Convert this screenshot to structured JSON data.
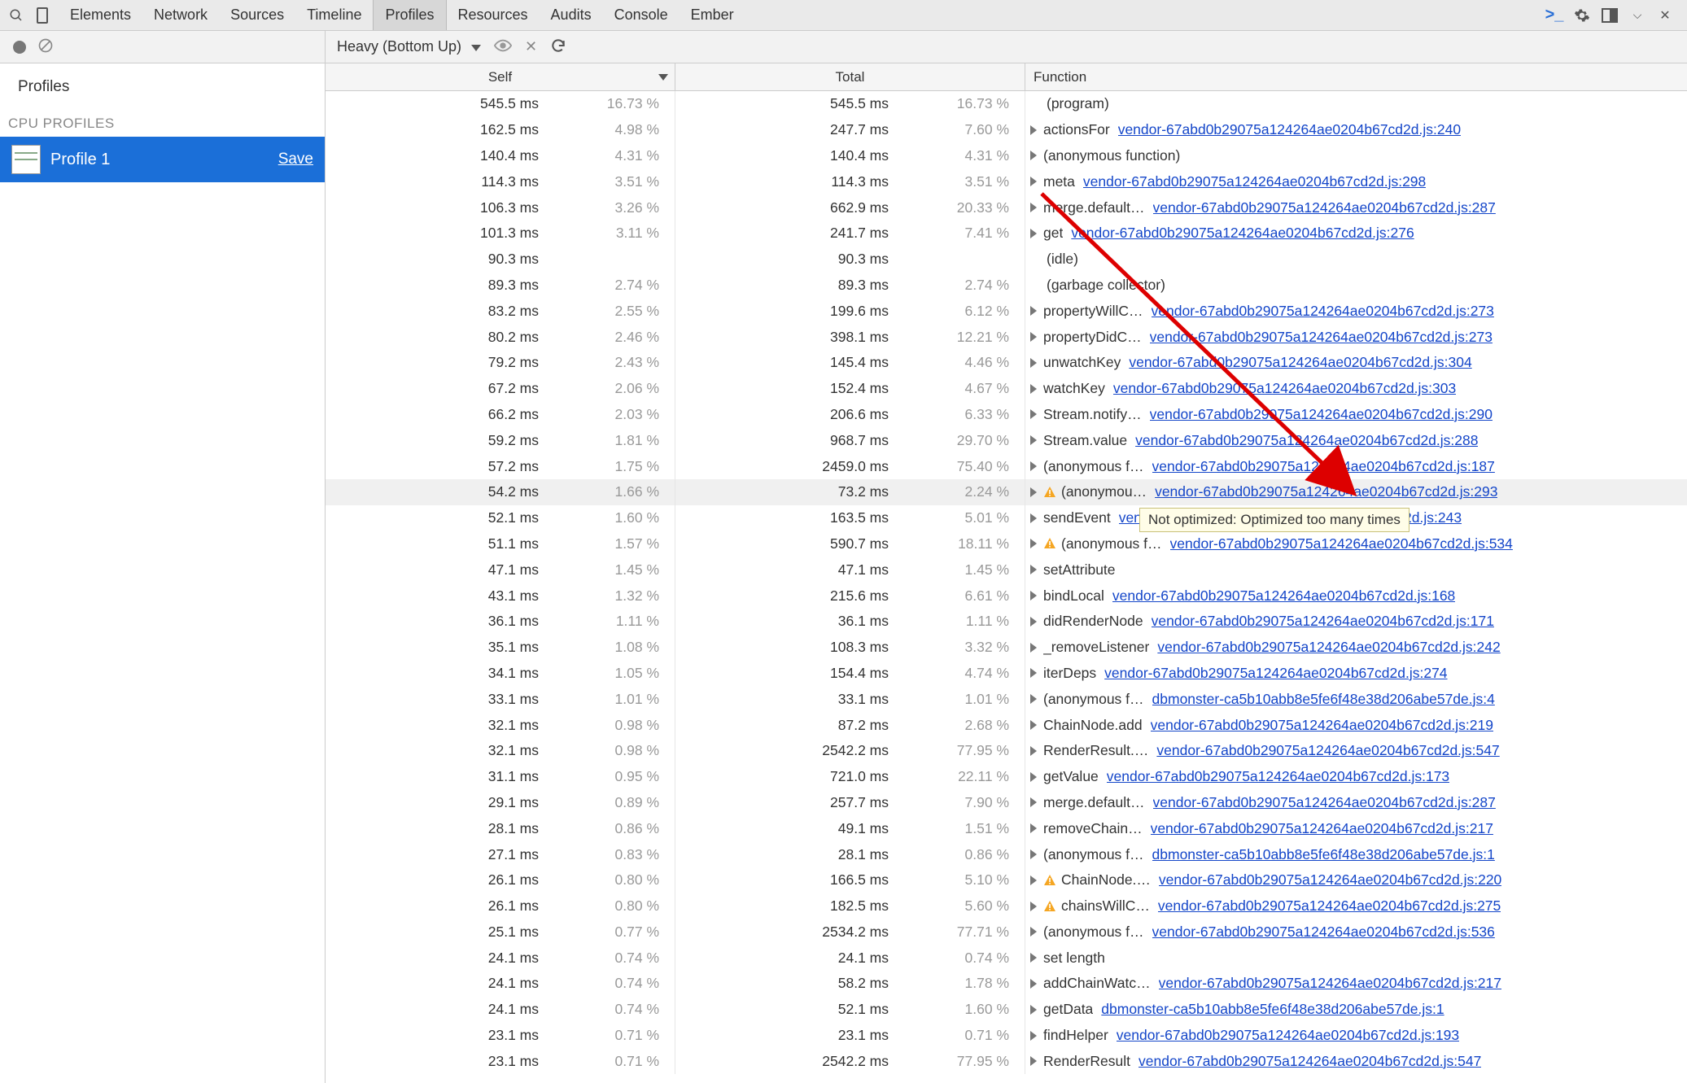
{
  "toolbar": {
    "tabs": [
      "Elements",
      "Network",
      "Sources",
      "Timeline",
      "Profiles",
      "Resources",
      "Audits",
      "Console",
      "Ember"
    ],
    "active_tab_index": 4
  },
  "subtoolbar": {
    "view_mode": "Heavy (Bottom Up)"
  },
  "sidebar": {
    "title": "Profiles",
    "section": "CPU PROFILES",
    "item_label": "Profile 1",
    "save_label": "Save"
  },
  "columns": {
    "self": "Self",
    "total": "Total",
    "fn": "Function"
  },
  "tooltip": "Not optimized: Optimized too many times",
  "rows": [
    {
      "self_ms": "545.5 ms",
      "self_pct": "16.73 %",
      "total_ms": "545.5 ms",
      "total_pct": "16.73 %",
      "fn": "(program)",
      "link": "",
      "expand": false,
      "warn": false
    },
    {
      "self_ms": "162.5 ms",
      "self_pct": "4.98 %",
      "total_ms": "247.7 ms",
      "total_pct": "7.60 %",
      "fn": "actionsFor",
      "link": "vendor-67abd0b29075a124264ae0204b67cd2d.js:240",
      "expand": true,
      "warn": false
    },
    {
      "self_ms": "140.4 ms",
      "self_pct": "4.31 %",
      "total_ms": "140.4 ms",
      "total_pct": "4.31 %",
      "fn": "(anonymous function)",
      "link": "",
      "expand": true,
      "warn": false
    },
    {
      "self_ms": "114.3 ms",
      "self_pct": "3.51 %",
      "total_ms": "114.3 ms",
      "total_pct": "3.51 %",
      "fn": "meta",
      "link": "vendor-67abd0b29075a124264ae0204b67cd2d.js:298",
      "expand": true,
      "warn": false
    },
    {
      "self_ms": "106.3 ms",
      "self_pct": "3.26 %",
      "total_ms": "662.9 ms",
      "total_pct": "20.33 %",
      "fn": "merge.default…",
      "link": "vendor-67abd0b29075a124264ae0204b67cd2d.js:287",
      "expand": true,
      "warn": false
    },
    {
      "self_ms": "101.3 ms",
      "self_pct": "3.11 %",
      "total_ms": "241.7 ms",
      "total_pct": "7.41 %",
      "fn": "get",
      "link": "vendor-67abd0b29075a124264ae0204b67cd2d.js:276",
      "expand": true,
      "warn": false
    },
    {
      "self_ms": "90.3 ms",
      "self_pct": "",
      "total_ms": "90.3 ms",
      "total_pct": "",
      "fn": "(idle)",
      "link": "",
      "expand": false,
      "warn": false
    },
    {
      "self_ms": "89.3 ms",
      "self_pct": "2.74 %",
      "total_ms": "89.3 ms",
      "total_pct": "2.74 %",
      "fn": "(garbage collector)",
      "link": "",
      "expand": false,
      "warn": false
    },
    {
      "self_ms": "83.2 ms",
      "self_pct": "2.55 %",
      "total_ms": "199.6 ms",
      "total_pct": "6.12 %",
      "fn": "propertyWillC…",
      "link": "vendor-67abd0b29075a124264ae0204b67cd2d.js:273",
      "expand": true,
      "warn": false
    },
    {
      "self_ms": "80.2 ms",
      "self_pct": "2.46 %",
      "total_ms": "398.1 ms",
      "total_pct": "12.21 %",
      "fn": "propertyDidC…",
      "link": "vendor-67abd0b29075a124264ae0204b67cd2d.js:273",
      "expand": true,
      "warn": false
    },
    {
      "self_ms": "79.2 ms",
      "self_pct": "2.43 %",
      "total_ms": "145.4 ms",
      "total_pct": "4.46 %",
      "fn": "unwatchKey",
      "link": "vendor-67abd0b29075a124264ae0204b67cd2d.js:304",
      "expand": true,
      "warn": false
    },
    {
      "self_ms": "67.2 ms",
      "self_pct": "2.06 %",
      "total_ms": "152.4 ms",
      "total_pct": "4.67 %",
      "fn": "watchKey",
      "link": "vendor-67abd0b29075a124264ae0204b67cd2d.js:303",
      "expand": true,
      "warn": false
    },
    {
      "self_ms": "66.2 ms",
      "self_pct": "2.03 %",
      "total_ms": "206.6 ms",
      "total_pct": "6.33 %",
      "fn": "Stream.notify…",
      "link": "vendor-67abd0b29075a124264ae0204b67cd2d.js:290",
      "expand": true,
      "warn": false
    },
    {
      "self_ms": "59.2 ms",
      "self_pct": "1.81 %",
      "total_ms": "968.7 ms",
      "total_pct": "29.70 %",
      "fn": "Stream.value",
      "link": "vendor-67abd0b29075a124264ae0204b67cd2d.js:288",
      "expand": true,
      "warn": false
    },
    {
      "self_ms": "57.2 ms",
      "self_pct": "1.75 %",
      "total_ms": "2459.0 ms",
      "total_pct": "75.40 %",
      "fn": "(anonymous f…",
      "link": "vendor-67abd0b29075a124264ae0204b67cd2d.js:187",
      "expand": true,
      "warn": false
    },
    {
      "self_ms": "54.2 ms",
      "self_pct": "1.66 %",
      "total_ms": "73.2 ms",
      "total_pct": "2.24 %",
      "fn": "(anonymou…",
      "link": "vendor-67abd0b29075a124264ae0204b67cd2d.js:293",
      "expand": true,
      "warn": true,
      "hl": true
    },
    {
      "self_ms": "52.1 ms",
      "self_pct": "1.60 %",
      "total_ms": "163.5 ms",
      "total_pct": "5.01 %",
      "fn": "sendEvent",
      "link": "vendor-67abd0b29075a124264ae0204b67cd2d.js:243",
      "expand": true,
      "warn": false
    },
    {
      "self_ms": "51.1 ms",
      "self_pct": "1.57 %",
      "total_ms": "590.7 ms",
      "total_pct": "18.11 %",
      "fn": "(anonymous f…",
      "link": "vendor-67abd0b29075a124264ae0204b67cd2d.js:534",
      "expand": true,
      "warn": true
    },
    {
      "self_ms": "47.1 ms",
      "self_pct": "1.45 %",
      "total_ms": "47.1 ms",
      "total_pct": "1.45 %",
      "fn": "setAttribute",
      "link": "",
      "expand": true,
      "warn": false
    },
    {
      "self_ms": "43.1 ms",
      "self_pct": "1.32 %",
      "total_ms": "215.6 ms",
      "total_pct": "6.61 %",
      "fn": "bindLocal",
      "link": "vendor-67abd0b29075a124264ae0204b67cd2d.js:168",
      "expand": true,
      "warn": false
    },
    {
      "self_ms": "36.1 ms",
      "self_pct": "1.11 %",
      "total_ms": "36.1 ms",
      "total_pct": "1.11 %",
      "fn": "didRenderNode",
      "link": "vendor-67abd0b29075a124264ae0204b67cd2d.js:171",
      "expand": true,
      "warn": false
    },
    {
      "self_ms": "35.1 ms",
      "self_pct": "1.08 %",
      "total_ms": "108.3 ms",
      "total_pct": "3.32 %",
      "fn": "_removeListener",
      "link": "vendor-67abd0b29075a124264ae0204b67cd2d.js:242",
      "expand": true,
      "warn": false
    },
    {
      "self_ms": "34.1 ms",
      "self_pct": "1.05 %",
      "total_ms": "154.4 ms",
      "total_pct": "4.74 %",
      "fn": "iterDeps",
      "link": "vendor-67abd0b29075a124264ae0204b67cd2d.js:274",
      "expand": true,
      "warn": false
    },
    {
      "self_ms": "33.1 ms",
      "self_pct": "1.01 %",
      "total_ms": "33.1 ms",
      "total_pct": "1.01 %",
      "fn": "(anonymous f…",
      "link": "dbmonster-ca5b10abb8e5fe6f48e38d206abe57de.js:4",
      "expand": true,
      "warn": false
    },
    {
      "self_ms": "32.1 ms",
      "self_pct": "0.98 %",
      "total_ms": "87.2 ms",
      "total_pct": "2.68 %",
      "fn": "ChainNode.add",
      "link": "vendor-67abd0b29075a124264ae0204b67cd2d.js:219",
      "expand": true,
      "warn": false
    },
    {
      "self_ms": "32.1 ms",
      "self_pct": "0.98 %",
      "total_ms": "2542.2 ms",
      "total_pct": "77.95 %",
      "fn": "RenderResult.…",
      "link": "vendor-67abd0b29075a124264ae0204b67cd2d.js:547",
      "expand": true,
      "warn": false
    },
    {
      "self_ms": "31.1 ms",
      "self_pct": "0.95 %",
      "total_ms": "721.0 ms",
      "total_pct": "22.11 %",
      "fn": "getValue",
      "link": "vendor-67abd0b29075a124264ae0204b67cd2d.js:173",
      "expand": true,
      "warn": false
    },
    {
      "self_ms": "29.1 ms",
      "self_pct": "0.89 %",
      "total_ms": "257.7 ms",
      "total_pct": "7.90 %",
      "fn": "merge.default…",
      "link": "vendor-67abd0b29075a124264ae0204b67cd2d.js:287",
      "expand": true,
      "warn": false
    },
    {
      "self_ms": "28.1 ms",
      "self_pct": "0.86 %",
      "total_ms": "49.1 ms",
      "total_pct": "1.51 %",
      "fn": "removeChain…",
      "link": "vendor-67abd0b29075a124264ae0204b67cd2d.js:217",
      "expand": true,
      "warn": false
    },
    {
      "self_ms": "27.1 ms",
      "self_pct": "0.83 %",
      "total_ms": "28.1 ms",
      "total_pct": "0.86 %",
      "fn": "(anonymous f…",
      "link": "dbmonster-ca5b10abb8e5fe6f48e38d206abe57de.js:1",
      "expand": true,
      "warn": false
    },
    {
      "self_ms": "26.1 ms",
      "self_pct": "0.80 %",
      "total_ms": "166.5 ms",
      "total_pct": "5.10 %",
      "fn": "ChainNode.…",
      "link": "vendor-67abd0b29075a124264ae0204b67cd2d.js:220",
      "expand": true,
      "warn": true
    },
    {
      "self_ms": "26.1 ms",
      "self_pct": "0.80 %",
      "total_ms": "182.5 ms",
      "total_pct": "5.60 %",
      "fn": "chainsWillC…",
      "link": "vendor-67abd0b29075a124264ae0204b67cd2d.js:275",
      "expand": true,
      "warn": true
    },
    {
      "self_ms": "25.1 ms",
      "self_pct": "0.77 %",
      "total_ms": "2534.2 ms",
      "total_pct": "77.71 %",
      "fn": "(anonymous f…",
      "link": "vendor-67abd0b29075a124264ae0204b67cd2d.js:536",
      "expand": true,
      "warn": false
    },
    {
      "self_ms": "24.1 ms",
      "self_pct": "0.74 %",
      "total_ms": "24.1 ms",
      "total_pct": "0.74 %",
      "fn": "set length",
      "link": "",
      "expand": true,
      "warn": false
    },
    {
      "self_ms": "24.1 ms",
      "self_pct": "0.74 %",
      "total_ms": "58.2 ms",
      "total_pct": "1.78 %",
      "fn": "addChainWatc…",
      "link": "vendor-67abd0b29075a124264ae0204b67cd2d.js:217",
      "expand": true,
      "warn": false
    },
    {
      "self_ms": "24.1 ms",
      "self_pct": "0.74 %",
      "total_ms": "52.1 ms",
      "total_pct": "1.60 %",
      "fn": "getData",
      "link": "dbmonster-ca5b10abb8e5fe6f48e38d206abe57de.js:1",
      "expand": true,
      "warn": false
    },
    {
      "self_ms": "23.1 ms",
      "self_pct": "0.71 %",
      "total_ms": "23.1 ms",
      "total_pct": "0.71 %",
      "fn": "findHelper",
      "link": "vendor-67abd0b29075a124264ae0204b67cd2d.js:193",
      "expand": true,
      "warn": false
    },
    {
      "self_ms": "23.1 ms",
      "self_pct": "0.71 %",
      "total_ms": "2542.2 ms",
      "total_pct": "77.95 %",
      "fn": "RenderResult",
      "link": "vendor-67abd0b29075a124264ae0204b67cd2d.js:547",
      "expand": true,
      "warn": false
    }
  ]
}
